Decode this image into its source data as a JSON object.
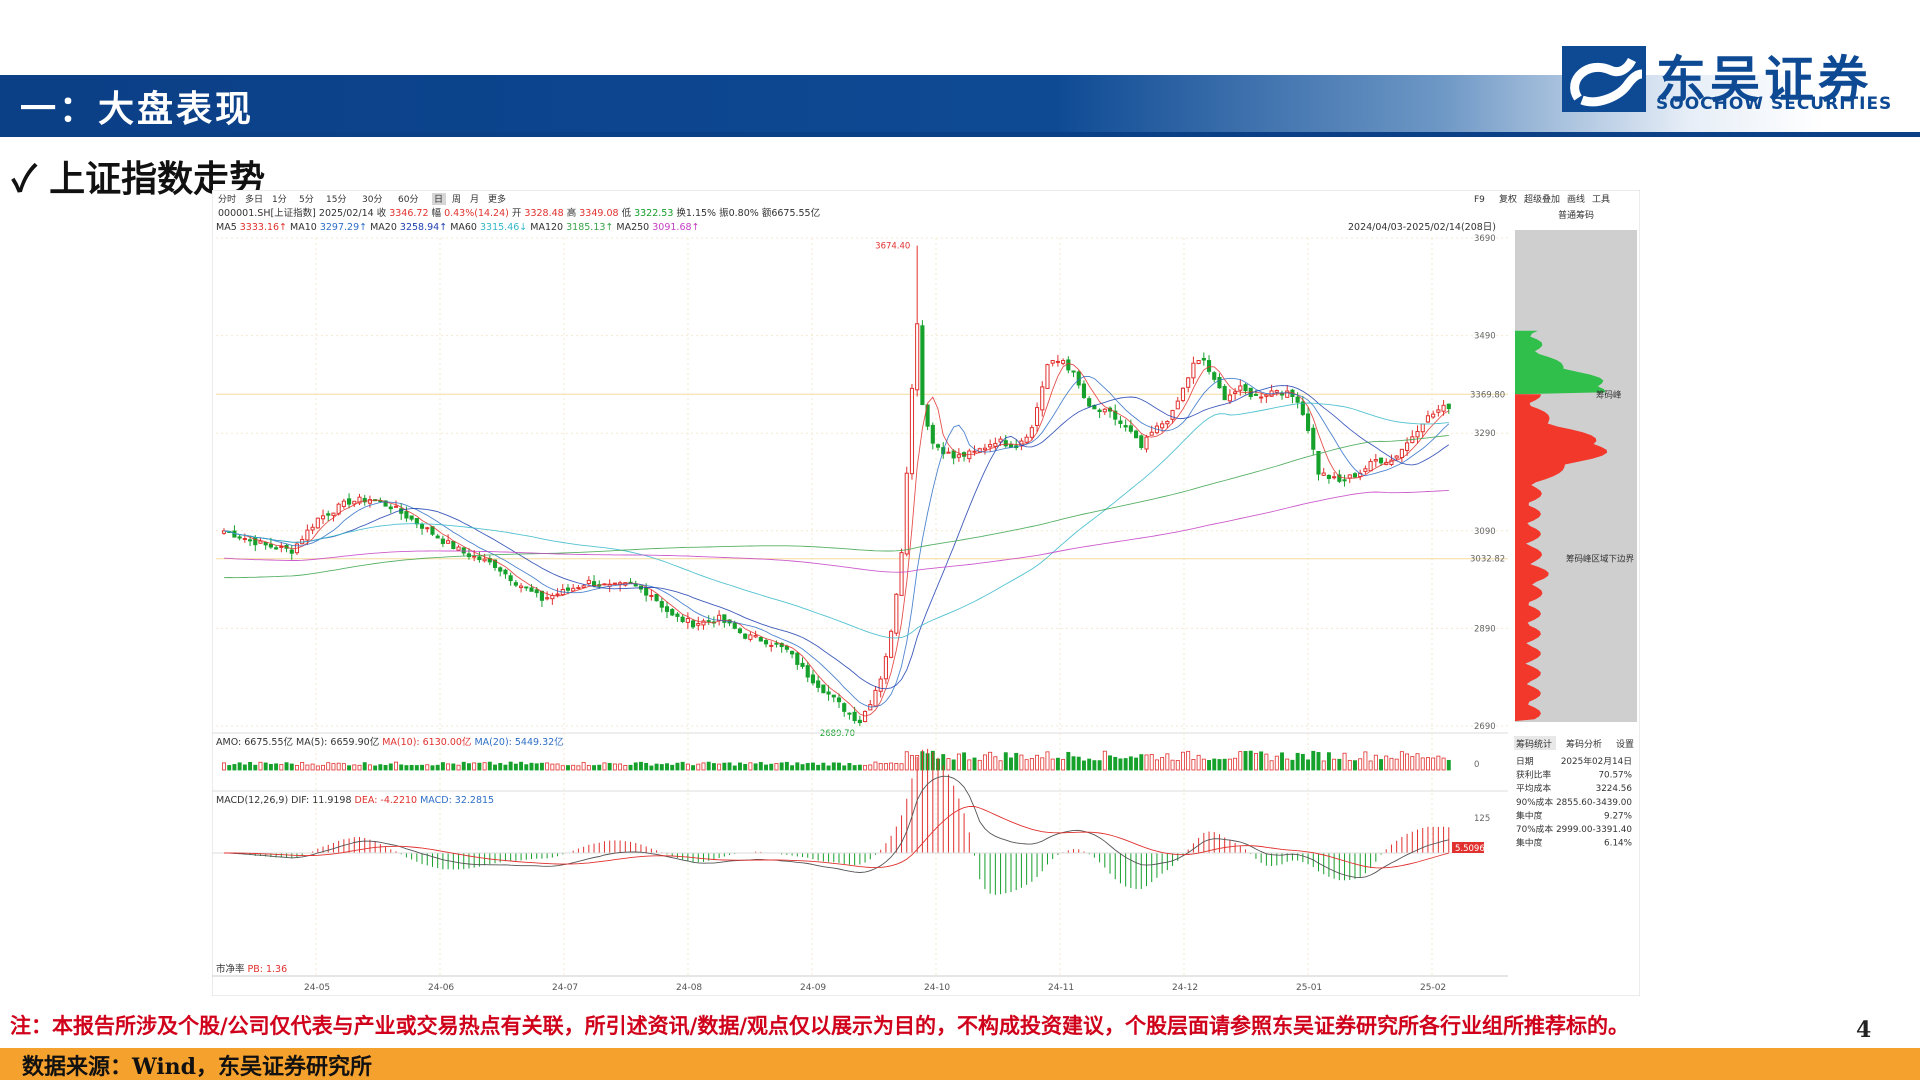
{
  "header": {
    "section_title": "一：大盘表现"
  },
  "brand": {
    "name_cn": "东吴证券",
    "name_en": "SOOCHOW SECURITIES",
    "color": "#0e4a94"
  },
  "subtitle": {
    "check": "✓",
    "text": "上证指数走势"
  },
  "toolbar": {
    "periods": [
      "分时",
      "多日",
      "1分",
      "5分",
      "15分",
      "30分",
      "60分",
      "日",
      "周",
      "月",
      "更多"
    ],
    "active_period": "日",
    "right_items": [
      "F9",
      "复权",
      "超级叠加",
      "画线",
      "工具"
    ],
    "panel_tab": "普通筹码"
  },
  "quote_line": {
    "code": "000001.SH[上证指数]",
    "date": "2025/02/14",
    "close_label": "收",
    "close": "3346.72",
    "change_label": "幅",
    "change": "0.43%(14.24)",
    "open_label": "开",
    "open": "3328.48",
    "high_label": "高",
    "high": "3349.08",
    "low_label": "低",
    "low": "3322.53",
    "turnover": "换1.15%",
    "amplitude": "振0.80%",
    "amount": "额6675.55亿"
  },
  "ma_line": [
    {
      "text": "MA5",
      "color": "#333333"
    },
    {
      "text": "3333.16↑",
      "color": "#e0312e"
    },
    {
      "text": "MA10",
      "color": "#333333"
    },
    {
      "text": "3297.29↑",
      "color": "#2f6fc7"
    },
    {
      "text": "MA20",
      "color": "#333333"
    },
    {
      "text": "3258.94↑",
      "color": "#1f3fb0"
    },
    {
      "text": "MA60",
      "color": "#333333"
    },
    {
      "text": "3315.46↓",
      "color": "#35b7c9"
    },
    {
      "text": "MA120",
      "color": "#333333"
    },
    {
      "text": "3185.13↑",
      "color": "#3aa34a"
    },
    {
      "text": "MA250",
      "color": "#333333"
    },
    {
      "text": "3091.68↑",
      "color": "#c43fc4"
    }
  ],
  "range_label": "2024/04/03-2025/02/14(208日)",
  "chart_data": {
    "type": "candlestick",
    "title": "",
    "x_tick_labels": [
      "24-05",
      "24-06",
      "24-07",
      "24-08",
      "24-09",
      "24-10",
      "24-11",
      "24-12",
      "25-01",
      "25-02"
    ],
    "y_tick_labels": [
      "3690",
      "3490",
      "3290",
      "3090",
      "2890",
      "2690"
    ],
    "ylim": [
      2690,
      3690
    ],
    "max_label": "3674.40",
    "min_label": "2689.70",
    "reference_levels": [
      {
        "value": 3369.8,
        "label": "3369.80"
      },
      {
        "value": 3032.82,
        "label": "3032.82"
      }
    ],
    "waypoints": [
      [
        0,
        3090
      ],
      [
        8,
        3060
      ],
      [
        13,
        3050
      ],
      [
        18,
        3115
      ],
      [
        24,
        3150
      ],
      [
        28,
        3155
      ],
      [
        32,
        3140
      ],
      [
        38,
        3100
      ],
      [
        42,
        3070
      ],
      [
        46,
        3045
      ],
      [
        52,
        3020
      ],
      [
        56,
        2985
      ],
      [
        61,
        2950
      ],
      [
        65,
        2965
      ],
      [
        70,
        2985
      ],
      [
        74,
        2975
      ],
      [
        78,
        2980
      ],
      [
        82,
        2960
      ],
      [
        86,
        2915
      ],
      [
        90,
        2900
      ],
      [
        95,
        2910
      ],
      [
        100,
        2875
      ],
      [
        104,
        2865
      ],
      [
        108,
        2845
      ],
      [
        112,
        2795
      ],
      [
        117,
        2745
      ],
      [
        120,
        2715
      ],
      [
        122,
        2700
      ],
      [
        124,
        2740
      ],
      [
        126,
        2790
      ],
      [
        128,
        2880
      ],
      [
        130,
        3050
      ],
      [
        132,
        3380
      ],
      [
        133,
        3520
      ],
      [
        134,
        3350
      ],
      [
        136,
        3270
      ],
      [
        140,
        3240
      ],
      [
        144,
        3250
      ],
      [
        148,
        3275
      ],
      [
        152,
        3265
      ],
      [
        155,
        3300
      ],
      [
        158,
        3430
      ],
      [
        161,
        3440
      ],
      [
        163,
        3410
      ],
      [
        166,
        3340
      ],
      [
        170,
        3330
      ],
      [
        174,
        3290
      ],
      [
        176,
        3260
      ],
      [
        178,
        3290
      ],
      [
        182,
        3330
      ],
      [
        186,
        3430
      ],
      [
        188,
        3440
      ],
      [
        190,
        3395
      ],
      [
        192,
        3365
      ],
      [
        195,
        3380
      ],
      [
        198,
        3365
      ],
      [
        202,
        3380
      ],
      [
        206,
        3360
      ],
      [
        208,
        3300
      ],
      [
        210,
        3210
      ],
      [
        214,
        3190
      ],
      [
        218,
        3210
      ],
      [
        221,
        3235
      ],
      [
        224,
        3235
      ],
      [
        227,
        3270
      ],
      [
        230,
        3315
      ],
      [
        233,
        3337
      ],
      [
        235,
        3346
      ]
    ],
    "moving_averages": [
      {
        "name": "MA5",
        "period": 5,
        "color": "#e0312e"
      },
      {
        "name": "MA10",
        "period": 10,
        "color": "#2f6fc7"
      },
      {
        "name": "MA20",
        "period": 20,
        "color": "#1f3fb0"
      },
      {
        "name": "MA60",
        "period": 60,
        "color": "#35b7c9"
      },
      {
        "name": "MA120",
        "period": 120,
        "color": "#3aa34a"
      },
      {
        "name": "MA250",
        "period": 250,
        "color": "#c43fc4"
      }
    ],
    "up_color": "#e0312e",
    "down_color": "#16a02c",
    "volume_panel": {
      "label": "AMO: 6675.55亿",
      "ma_labels": [
        {
          "text": "MA(5): 6659.90亿",
          "color": "#333333"
        },
        {
          "text": "MA(10): 6130.00亿",
          "color": "#e0312e"
        },
        {
          "text": "MA(20): 5449.32亿",
          "color": "#2f6fc7"
        }
      ],
      "zero_label": "0"
    },
    "macd_panel": {
      "label": "MACD(12,26,9)",
      "dif": "DIF: 11.9198",
      "dea": "DEA: -4.2210",
      "macd": "MACD: 32.2815",
      "top_label": "125",
      "value_badge": "5.5096",
      "pb_label": "市净率",
      "pb_value": "PB: 1.36"
    }
  },
  "chip_panel": {
    "peak_label": "筹码峰",
    "lower_label": "筹码峰区域下边界",
    "tabs": [
      "筹码统计",
      "筹码分析",
      "设置"
    ],
    "stats": [
      {
        "k": "日期",
        "v": "2025年02月14日"
      },
      {
        "k": "获利比率",
        "v": "70.57%"
      },
      {
        "k": "平均成本",
        "v": "3224.56"
      },
      {
        "k": "90%成本",
        "v": "2855.60-3439.00"
      },
      {
        "k": "集中度",
        "v": "9.27%"
      },
      {
        "k": "70%成本",
        "v": "2999.00-3391.40"
      },
      {
        "k": "集中度",
        "v": "6.14%"
      }
    ]
  },
  "footer": {
    "note": "注：本报告所涉及个股/公司仅代表与产业或交易热点有关联，所引述资讯/数据/观点仅以展示为目的，不构成投资建议，个股层面请参照东吴证券研究所各行业组所推荐标的。",
    "page_number": "4",
    "source": "数据来源：Wind，东吴证券研究所"
  }
}
